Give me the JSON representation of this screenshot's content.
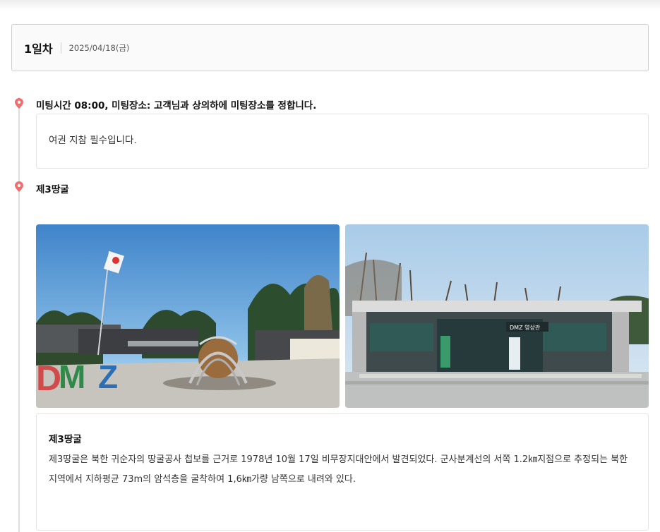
{
  "day": {
    "title": "1일차",
    "date": "2025/04/18(금)"
  },
  "stops": [
    {
      "title": "미팅시간 08:00, 미팅장소: 고객님과 상의하에 미팅장소를 정합니다.",
      "note": "여권 지참 필수입니다."
    },
    {
      "title": "제3땅굴",
      "photos": [
        {
          "alt": "DMZ 조형물과 태극기",
          "sign_text": "DMZ"
        },
        {
          "alt": "DMZ 영상관 건물",
          "sign_text": "DMZ 영상관"
        }
      ],
      "description_title": "제3땅굴",
      "description": "제3땅굴은 북한 귀순자의 땅굴공사 첩보를 근거로 1978년 10월 17일 비무장지대안에서 발견되었다. 군사분계선의 서쪽 1.2㎞지점으로 추정되는 북한지역에서 지하평균 73m의 암석층을 굴착하여 1,6㎞가량 남쪽으로 내려와 있다."
    }
  ],
  "colors": {
    "pin": "#f26d6d",
    "timeline": "#dddddd",
    "border": "#cfcfcf"
  },
  "icons": {
    "pin": "map-pin-icon"
  }
}
